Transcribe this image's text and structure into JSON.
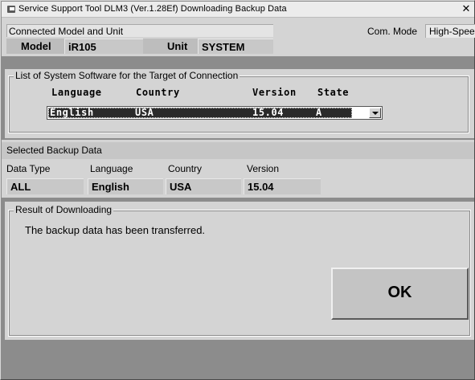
{
  "window": {
    "title": "Service Support Tool DLM3 (Ver.1.28Ef) Downloading Backup Data",
    "close_glyph": "✕"
  },
  "connection": {
    "header": "Connected Model and Unit",
    "model_label": "Model",
    "model_value": "iR105",
    "unit_label": "Unit",
    "unit_value": "SYSTEM",
    "com_mode_label": "Com. Mode",
    "com_mode_value": "High-Speed"
  },
  "system_software": {
    "legend": "List of System Software for the Target of Connection",
    "headers": {
      "language": "Language",
      "country": "Country",
      "version": "Version",
      "state": "State"
    },
    "selected": {
      "language": "English",
      "country": "USA",
      "version": "15.04",
      "state": "A"
    }
  },
  "selected_backup": {
    "header": "Selected Backup Data",
    "labels": {
      "data_type": "Data Type",
      "language": "Language",
      "country": "Country",
      "version": "Version"
    },
    "values": {
      "data_type": "ALL",
      "language": "English",
      "country": "USA",
      "version": "15.04"
    }
  },
  "result": {
    "legend": "Result of Downloading",
    "message": "The backup data has been transferred.",
    "ok_label": "OK"
  }
}
